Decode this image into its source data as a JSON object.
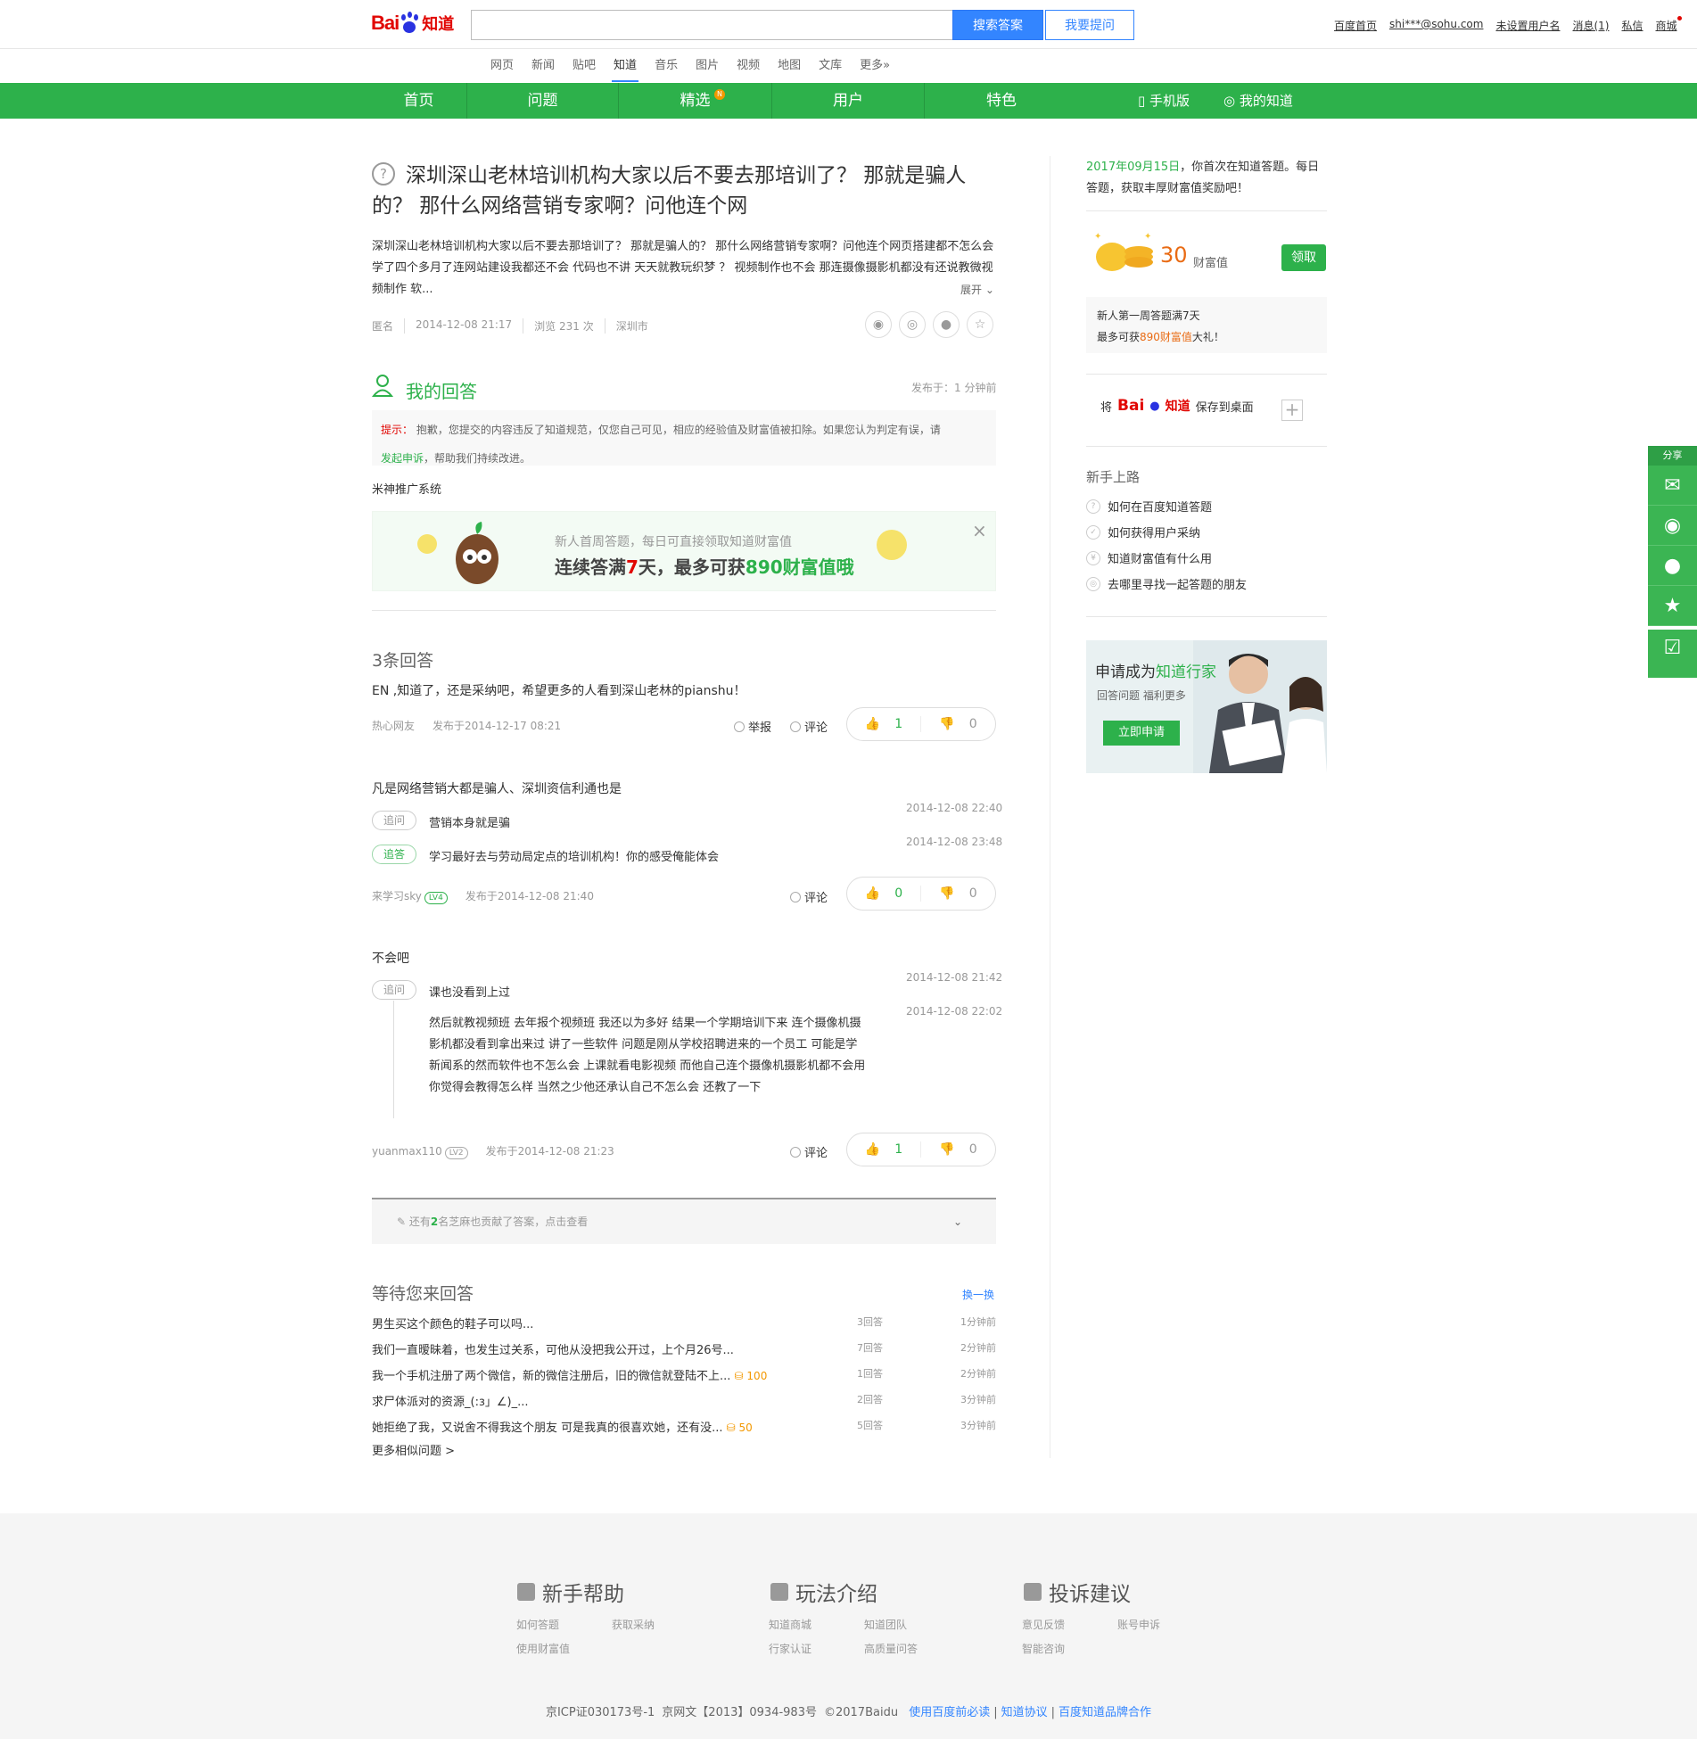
{
  "header": {
    "logo_text1": "Bai",
    "logo_text2": "知道",
    "search_button": "搜索答案",
    "ask_button": "我要提问",
    "user_links": [
      "百度首页",
      "shi***@sohu.com",
      "未设置用户名",
      "消息(1)",
      "私信",
      "商城"
    ]
  },
  "subnav": [
    "网页",
    "新闻",
    "贴吧",
    "知道",
    "音乐",
    "图片",
    "视频",
    "地图",
    "文库",
    "更多»"
  ],
  "greennav": {
    "items": [
      "首页",
      "问题",
      "精选",
      "用户",
      "特色"
    ],
    "badge": "N",
    "mobile": "手机版",
    "my_zhidao": "我的知道"
  },
  "question": {
    "title": "深圳深山老林培训机构大家以后不要去那培训了？ 那就是骗人的？ 那什么网络营销专家啊？问他连个网",
    "description": "深圳深山老林培训机构大家以后不要去那培训了？ 那就是骗人的？ 那什么网络营销专家啊？问他连个网页搭建都不怎么会 学了四个多月了连网站建设我都还不会 代码也不讲 天天就教玩织梦 ？ 视频制作也不会 那连摄像摄影机都没有还说教微视频制作 软...",
    "expand": "展开",
    "meta": [
      "匿名",
      "2014-12-08 21:17",
      "浏览 231 次",
      "深圳市"
    ]
  },
  "my_answer": {
    "title": "我的回答",
    "time": "发布于：1 分钟前",
    "tip_label": "提示：",
    "tip_text": "抱歉，您提交的内容违反了知道规范，仅您自己可见，相应的经验值及财富值被扣除。如果您认为判定有误，请",
    "tip_link": "发起申诉",
    "tip_tail": "，帮助我们持续改进。",
    "content": "米神推广系统",
    "promo_line1": "新人首周答题，每日可直接领取知道财富值",
    "promo_line2a": "连续答满",
    "promo_line2b": "7",
    "promo_line2c": "天，最多可获",
    "promo_line2d": "890财富值哦",
    "promo_close": "×"
  },
  "answers": {
    "count_label": "3条回答",
    "list": [
      {
        "text": "EN ,知道了，还是采纳吧，希望更多的人看到深山老林的pianshu！",
        "user": "热心网友",
        "time": "发布于2014-12-17 08:21",
        "report": "举报",
        "comment": "评论",
        "up": "1",
        "down": "0"
      },
      {
        "text": "凡是网络营销大都是骗人、深圳资信利通也是",
        "follow": [
          {
            "tag": "追问",
            "text": "营销本身就是骗",
            "time": "2014-12-08 22:40"
          },
          {
            "tag": "追答",
            "text": "学习最好去与劳动局定点的培训机构！你的感受俺能体会",
            "time": "2014-12-08 23:48"
          }
        ],
        "user": "来学习sky",
        "level": "LV4",
        "time": "发布于2014-12-08 21:40",
        "comment": "评论",
        "up": "0",
        "down": "0"
      },
      {
        "text": "不会吧",
        "follow": [
          {
            "tag": "追问",
            "text": "课也没看到上过",
            "time": "2014-12-08 21:42"
          },
          {
            "tag": "",
            "text": "然后就教视频班  去年报个视频班   我还以为多好   结果一个学期培训下来   连个摄像机摄影机都没看到拿出来过 讲了一些软件  问题是刚从学校招聘进来的一个员工  可能是学新闻系的然而软件也不怎么会  上课就看电影视频    而他自己连个摄像机摄影机都不会用   你觉得会教得怎么样  当然之少他还承认自己不怎么会  还教了一下",
            "time": "2014-12-08 22:02"
          }
        ],
        "user": "yuanmax110",
        "level": "LV2",
        "time": "发布于2014-12-08 21:23",
        "comment": "评论",
        "up": "1",
        "down": "0"
      }
    ],
    "more_a": "还有",
    "more_b": "2",
    "more_c": "名芝麻也贡献了答案，点击查看"
  },
  "waiting": {
    "title": "等待您来回答",
    "refresh": "换一换",
    "rows": [
      {
        "q": "男生买这个颜色的鞋子可以吗...",
        "coin": "",
        "count": "3回答",
        "time": "1分钟前"
      },
      {
        "q": "我们一直暧昧着，也发生过关系，可他从没把我公开过，上个月26号...",
        "coin": "",
        "count": "7回答",
        "time": "2分钟前"
      },
      {
        "q": "我一个手机注册了两个微信，新的微信注册后，旧的微信就登陆不上...",
        "coin": "100",
        "count": "1回答",
        "time": "2分钟前"
      },
      {
        "q": "求尸体派对的资源_(:з」∠)_...",
        "coin": "",
        "count": "2回答",
        "time": "3分钟前"
      },
      {
        "q": "她拒绝了我，又说舍不得我这个朋友 可是我真的很喜欢她，还有没...",
        "coin": "50",
        "count": "5回答",
        "time": "3分钟前"
      }
    ],
    "more": "更多相似问题 >"
  },
  "right": {
    "date": "2017年09月15日",
    "date_text": "，你首次在知道答题。每日答题，获取丰厚财富值奖励吧！",
    "coin_num": "30",
    "coin_label": "财富值",
    "claim": "领取",
    "week_line1": "新人第一周答题满7天",
    "week_line2a": "最多可获",
    "week_line2b": "890财富值",
    "week_line2c": "大礼！",
    "save_pre": "将",
    "save_post": "保存到桌面",
    "beginner_title": "新手上路",
    "beginner_items": [
      "如何在百度知道答题",
      "如何获得用户采纳",
      "知道财富值有什么用",
      "去哪里寻找一起答题的朋友"
    ],
    "expert_title_a": "申请成为",
    "expert_title_b": "知道行家",
    "expert_sub": "回答问题   福利更多",
    "expert_btn": "立即申请"
  },
  "side_share": {
    "label": "分享"
  },
  "footer": {
    "cols": [
      {
        "title": "新手帮助",
        "links": [
          "如何答题",
          "获取采纳",
          "使用财富值"
        ]
      },
      {
        "title": "玩法介绍",
        "links": [
          "知道商城",
          "知道团队",
          "行家认证",
          "高质量问答"
        ]
      },
      {
        "title": "投诉建议",
        "links": [
          "意见反馈",
          "账号申诉",
          "智能咨询"
        ]
      }
    ],
    "copy": [
      "京ICP证030173号-1",
      "京网文【2013】0934-983号",
      "©2017Baidu"
    ],
    "links": [
      "使用百度前必读",
      "知道协议",
      "百度知道品牌合作"
    ]
  },
  "colors": {
    "brand_green": "#2db14b",
    "link_blue": "#3385ff",
    "logo_red": "#e10602"
  }
}
